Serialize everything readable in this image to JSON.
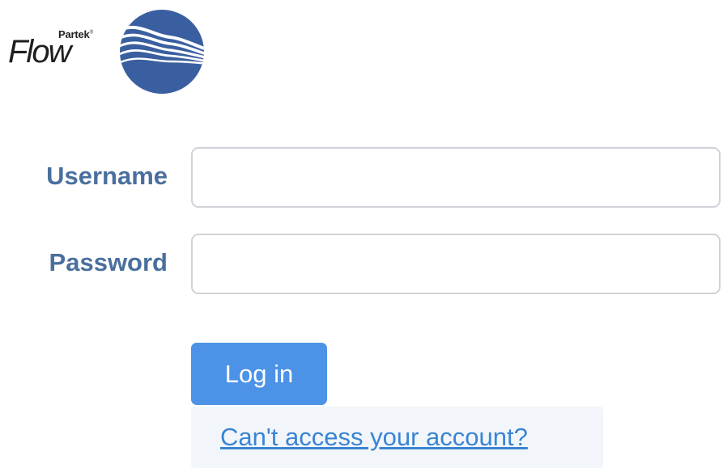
{
  "logo": {
    "company": "Partek",
    "trademark": "®",
    "product": "Flow",
    "mark_icon": "wave-globe-icon",
    "mark_color": "#3a5fa0"
  },
  "form": {
    "username_label": "Username",
    "username_value": "",
    "password_label": "Password",
    "password_value": "",
    "login_label": "Log in",
    "help_link": "Can't access your account?"
  },
  "colors": {
    "label": "#4a6f9e",
    "button": "#4c92e6",
    "link": "#3a84d4"
  }
}
